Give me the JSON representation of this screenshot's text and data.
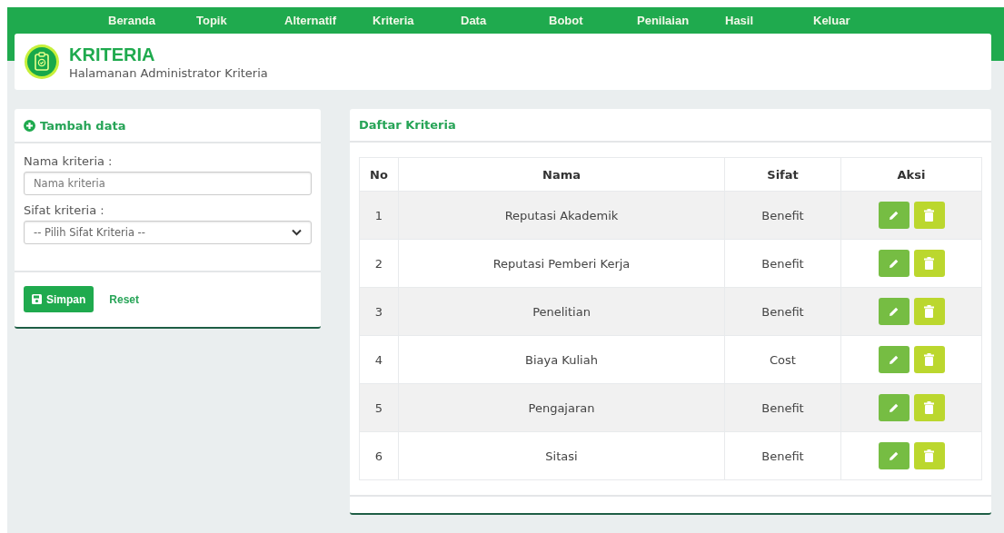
{
  "nav": {
    "items": [
      "Beranda",
      "Topik",
      "Alternatif",
      "Kriteria",
      "Data",
      "Bobot",
      "Penilaian",
      "Hasil",
      "Keluar"
    ]
  },
  "header": {
    "title": "KRITERIA",
    "subtitle": "Halamanan Administrator Kriteria"
  },
  "form": {
    "title": "Tambah data",
    "fields": [
      {
        "kind": "input",
        "label": "Nama kriteria :",
        "placeholder": "Nama kriteria"
      },
      {
        "kind": "select",
        "label": "Sifat kriteria :",
        "value": "-- Pilih Sifat Kriteria --"
      }
    ],
    "buttons": [
      {
        "kind": "primary",
        "label": "Simpan"
      },
      {
        "kind": "link",
        "label": "Reset"
      }
    ]
  },
  "list": {
    "title": "Daftar Kriteria",
    "columns": [
      "No",
      "Nama",
      "Sifat",
      "Aksi"
    ],
    "rows": [
      {
        "no": "1",
        "nama": "Reputasi Akademik",
        "sifat": "Benefit"
      },
      {
        "no": "2",
        "nama": "Reputasi Pemberi Kerja",
        "sifat": "Benefit"
      },
      {
        "no": "3",
        "nama": "Penelitian",
        "sifat": "Benefit"
      },
      {
        "no": "4",
        "nama": "Biaya Kuliah",
        "sifat": "Cost"
      },
      {
        "no": "5",
        "nama": "Pengajaran",
        "sifat": "Benefit"
      },
      {
        "no": "6",
        "nama": "Sitasi",
        "sifat": "Benefit"
      }
    ]
  }
}
